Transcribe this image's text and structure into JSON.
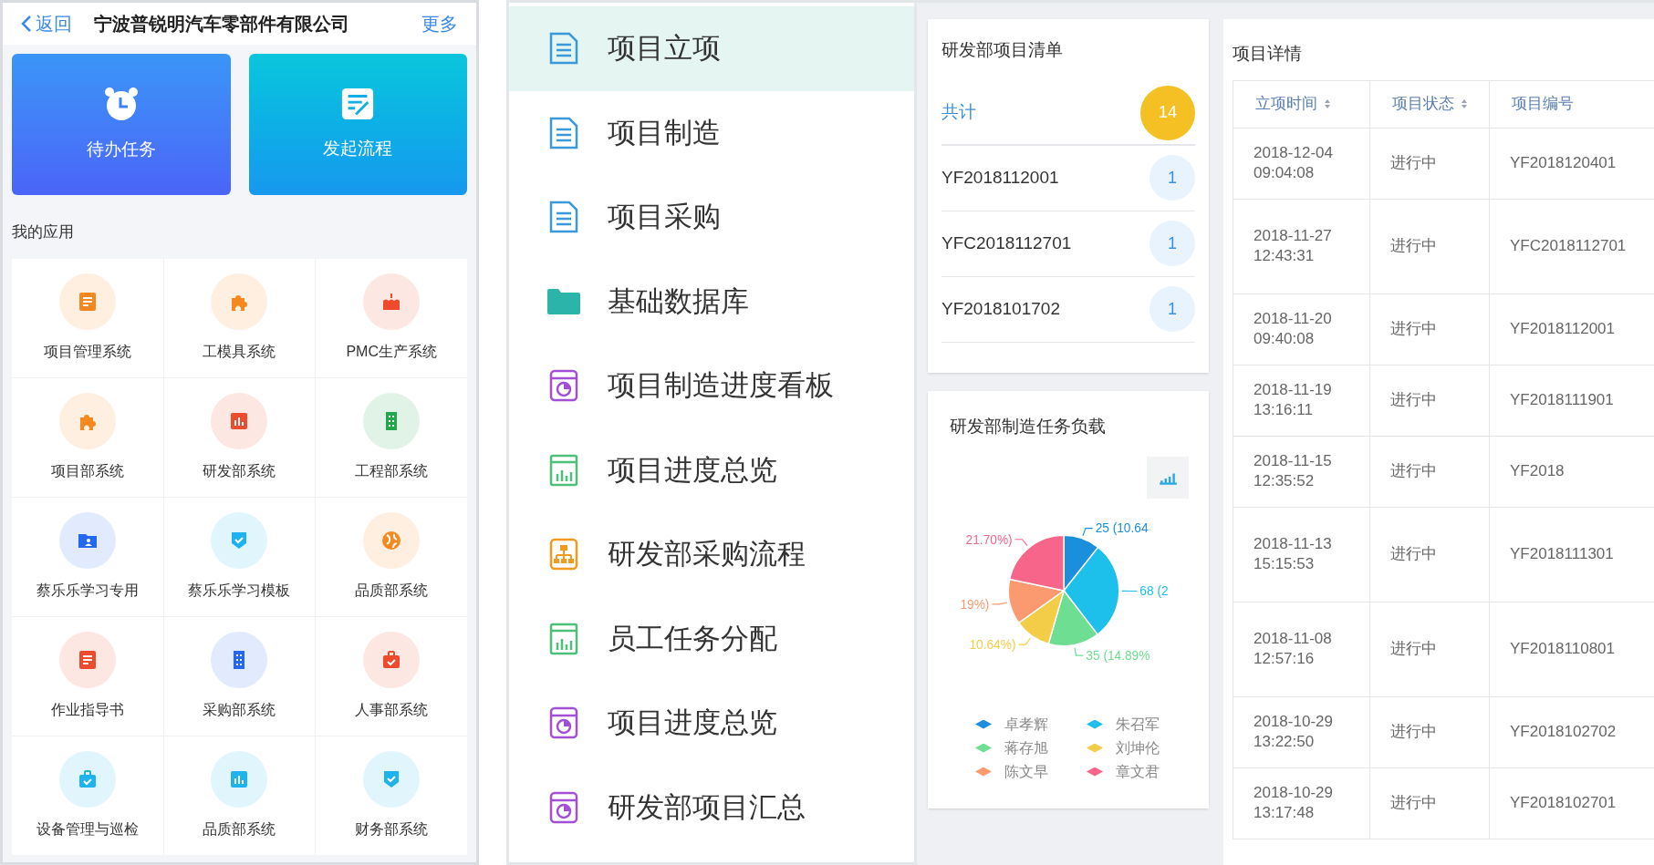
{
  "mobile": {
    "back": "返回",
    "title": "宁波普锐明汽车零部件有限公司",
    "more": "更多",
    "cards": [
      {
        "label": "待办任务",
        "kind": "alarm"
      },
      {
        "label": "发起流程",
        "kind": "form"
      }
    ],
    "section_title": "我的应用",
    "apps": [
      {
        "label": "项目管理系统",
        "kind": "doc",
        "color": "#f5891f"
      },
      {
        "label": "工模具系统",
        "kind": "puzzle",
        "color": "#f5891f"
      },
      {
        "label": "PMC生产系统",
        "kind": "cake",
        "color": "#ee4a2c"
      },
      {
        "label": "项目部系统",
        "kind": "puzzle",
        "color": "#f5891f"
      },
      {
        "label": "研发部系统",
        "kind": "bars",
        "color": "#ee4a2c"
      },
      {
        "label": "工程部系统",
        "kind": "building",
        "color": "#21a84a"
      },
      {
        "label": "蔡乐乐学习专用",
        "kind": "folder",
        "color": "#2268f0"
      },
      {
        "label": "蔡乐乐学习模板",
        "kind": "shield",
        "color": "#1fb3ee"
      },
      {
        "label": "品质部系统",
        "kind": "globe",
        "color": "#f5891f"
      },
      {
        "label": "作业指导书",
        "kind": "doc",
        "color": "#ee4a2c"
      },
      {
        "label": "采购部系统",
        "kind": "building",
        "color": "#2268f0"
      },
      {
        "label": "人事部系统",
        "kind": "case",
        "color": "#ee4a2c"
      },
      {
        "label": "设备管理与巡检",
        "kind": "case",
        "color": "#1fb3ee"
      },
      {
        "label": "品质部系统",
        "kind": "bars",
        "color": "#1fb3ee"
      },
      {
        "label": "财务部系统",
        "kind": "shield",
        "color": "#1fb3ee"
      }
    ]
  },
  "menu": {
    "items": [
      {
        "label": "项目立项",
        "kind": "doc",
        "selected": true
      },
      {
        "label": "项目制造",
        "kind": "doc",
        "selected": false
      },
      {
        "label": "项目采购",
        "kind": "doc",
        "selected": false
      },
      {
        "label": "基础数据库",
        "kind": "folder",
        "selected": false
      },
      {
        "label": "项目制造进度看板",
        "kind": "dial",
        "selected": false
      },
      {
        "label": "项目进度总览",
        "kind": "chart",
        "selected": false
      },
      {
        "label": "研发部采购流程",
        "kind": "org",
        "selected": false
      },
      {
        "label": "员工任务分配",
        "kind": "chart",
        "selected": false
      },
      {
        "label": "项目进度总览",
        "kind": "dial",
        "selected": false
      },
      {
        "label": "研发部项目汇总",
        "kind": "dial",
        "selected": false
      }
    ]
  },
  "project_list": {
    "title": "研发部项目清单",
    "total_label": "共计",
    "total_count": "14",
    "rows": [
      {
        "code": "YF2018112001",
        "count": "1"
      },
      {
        "code": "YFC2018112701",
        "count": "1"
      },
      {
        "code": "YF2018101702",
        "count": "1"
      }
    ]
  },
  "workload": {
    "title": "研发部制造任务负载",
    "chart_data": {
      "type": "pie",
      "categories": [
        "卓孝辉",
        "朱召军",
        "蒋存旭",
        "刘坤伦",
        "陈文早",
        "章文君"
      ],
      "values": [
        10.64,
        28.94,
        14.89,
        10.64,
        13.19,
        21.7
      ],
      "colors": [
        "#1b8fdc",
        "#1cc0ea",
        "#6ede92",
        "#f3cd48",
        "#fb9a70",
        "#f7668a"
      ]
    },
    "slice_labels": [
      "25 (10.64",
      "21.70%)",
      "68 (2",
      "19%)",
      "10.64%)",
      "35 (14.89%"
    ]
  },
  "details": {
    "title": "项目详情",
    "columns": [
      "立项时间",
      "项目状态",
      "项目编号"
    ],
    "rows": [
      [
        "2018-12-04\n09:04:08",
        "进行中",
        "YF2018120401"
      ],
      [
        "2018-11-27\n12:43:31",
        "进行中",
        "YFC2018112701"
      ],
      [
        "2018-11-20\n09:40:08",
        "进行中",
        "YF2018112001"
      ],
      [
        "2018-11-19\n13:16:11",
        "进行中",
        "YF2018111901"
      ],
      [
        "2018-11-15\n12:35:52",
        "进行中",
        "YF2018"
      ],
      [
        "2018-11-13\n15:15:53",
        "进行中",
        "YF2018111301"
      ],
      [
        "2018-11-08\n12:57:16",
        "进行中",
        "YF2018110801"
      ],
      [
        "2018-10-29\n13:22:50",
        "进行中",
        "YF2018102702"
      ],
      [
        "2018-10-29\n13:17:48",
        "进行中",
        "YF2018102701"
      ]
    ]
  }
}
